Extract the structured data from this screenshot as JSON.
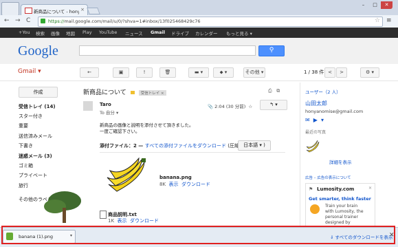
{
  "browser": {
    "tab_title": "新商品について - honyano",
    "tab_close": "×",
    "url_secure": "https://",
    "url_rest": "mail.google.com/mail/u/0/?shva=1#inbox/13f025468429c76",
    "nav_back": "←",
    "nav_forward": "→",
    "nav_reload": "C",
    "star": "☆",
    "menu": "≡",
    "win_min": "–",
    "win_max": "□",
    "win_close": "✕"
  },
  "gbar": {
    "items": [
      "+You",
      "検索",
      "画像",
      "地図",
      "Play",
      "YouTube",
      "ニュース",
      "Gmail",
      "ドライブ",
      "カレンダー",
      "もっと見る ▾"
    ]
  },
  "header": {
    "logo": "Google",
    "search_icon": "search-icon"
  },
  "toolbar": {
    "gmail_label": "Gmail ▾",
    "back": "←",
    "archive": "▣",
    "spam": "!",
    "delete": "🗑",
    "folder": "▬ ▾",
    "label": "⬥ ▾",
    "more": "その他 ▾",
    "pager": "1 / 38 件",
    "prev": "<",
    "next": ">",
    "settings": "⚙ ▾"
  },
  "sidebar": {
    "compose": "作成",
    "items": [
      {
        "label": "受信トレイ (14)",
        "bold": true
      },
      {
        "label": "スター付き",
        "bold": false
      },
      {
        "label": "重要",
        "bold": false
      },
      {
        "label": "送信済みメール",
        "bold": false
      },
      {
        "label": "下書き",
        "bold": false
      },
      {
        "label": "迷惑メール (3)",
        "bold": true
      },
      {
        "label": "ゴミ箱",
        "bold": false
      },
      {
        "label": "プライベート",
        "bold": false
      },
      {
        "label": "旅行",
        "bold": false
      },
      {
        "label": "その他のラベル ▾",
        "bold": false
      }
    ]
  },
  "mail": {
    "subject": "新商品について",
    "tag": "受信トレイ ×",
    "print": "⎙",
    "newwin": "⧉",
    "sender": "Taro",
    "to": "To 自分 ▾",
    "time": "2:04 (30 分前)",
    "star": "☆",
    "reply": "↰ ▾",
    "body": [
      "新商品の画像と説明を添付させて頂きました。",
      "一度ご確認下さい。"
    ],
    "attach_label": "添付ファイル：2 — ",
    "attach_download_all": "すべての添付ファイルをダウンロード",
    "attach_compress": "(圧縮:",
    "attach_lang": "日本語 ▾",
    "attach_close": ")",
    "attachments": [
      {
        "name": "banana.png",
        "size": "8K",
        "view": "表示",
        "download": "ダウンロード"
      },
      {
        "name": "商品説明.txt",
        "size": "1K",
        "view": "表示",
        "download": "ダウンロード"
      }
    ]
  },
  "right_panel": {
    "users_heading": "ユーザー（2 人）",
    "contact_name": "山田太郎",
    "contact_email": "honyanomise@gmail.com",
    "recent_photos": "最近の写真",
    "show_details": "詳細を表示",
    "ads_label": "広告 – 広告の表示について",
    "ad_title": "Lumosity.com",
    "ad_close": "✕",
    "ad_headline": "Get smarter, think faster",
    "ad_lines": [
      "Train your brain",
      "with Lumosity, the",
      "personal trainer",
      "designed by"
    ]
  },
  "downloads": {
    "file_name": "banana (1).png",
    "arrow": "▾",
    "show_all": "すべてのダウンロードを表示",
    "close": "✕"
  },
  "colors": {
    "accent_red": "#e02020",
    "google_blue": "#4d90fe",
    "link": "#1155cc",
    "gmail_red": "#c23321"
  }
}
